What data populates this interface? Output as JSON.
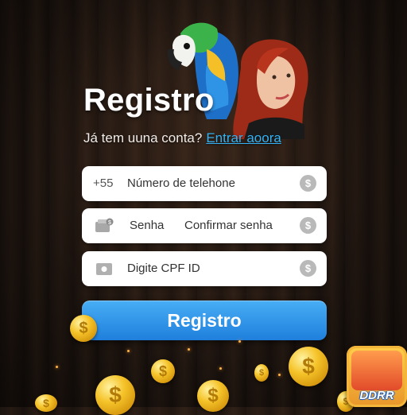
{
  "header": {
    "title": "Registro",
    "subtitle": "Já tem uuna conta?",
    "login_link": "Entrar aoora"
  },
  "form": {
    "phone": {
      "prefix": "+55",
      "placeholder": "Número de telehone"
    },
    "password": {
      "placeholder": "Senha",
      "confirm_placeholder": "Confirmar senha"
    },
    "cpf": {
      "placeholder": "Digite CPF ID"
    },
    "submit_label": "Registro"
  },
  "app_icon": {
    "label": "DDRR"
  },
  "icons": {
    "coin": "$"
  },
  "colors": {
    "accent": "#2a8fe8",
    "link": "#33b3f5",
    "field_icon": "#b9b9b9"
  }
}
